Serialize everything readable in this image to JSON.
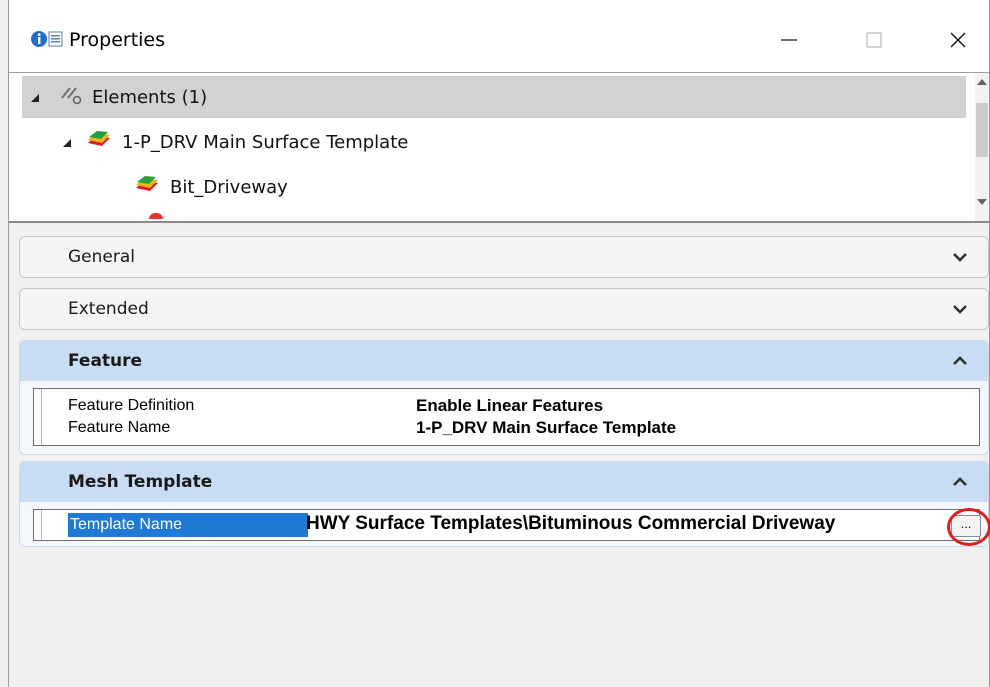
{
  "window": {
    "title": "Properties",
    "icons": [
      "properties-info-icon",
      "minimize-icon",
      "maximize-icon",
      "close-icon"
    ]
  },
  "tree": {
    "root": {
      "label": "Elements (1)"
    },
    "child": {
      "label": "1-P_DRV Main Surface Template"
    },
    "grandchild": {
      "label": "Bit_Driveway"
    }
  },
  "sections": {
    "general": {
      "title": "General"
    },
    "extended": {
      "title": "Extended"
    },
    "feature": {
      "title": "Feature",
      "rows": [
        {
          "label": "Feature Definition",
          "value": "Enable Linear Features"
        },
        {
          "label": "Feature Name",
          "value": "1-P_DRV Main Surface Template"
        }
      ]
    },
    "mesh": {
      "title": "Mesh Template",
      "row": {
        "label": "Template Name",
        "value": "HWY Surface Templates\\Bituminous Commercial Driveway",
        "button": "..."
      }
    }
  },
  "colors": {
    "selection_blue": "#1e7ad4",
    "section_header_blue": "#c8dcf3",
    "highlight_red": "#e21b1b"
  }
}
